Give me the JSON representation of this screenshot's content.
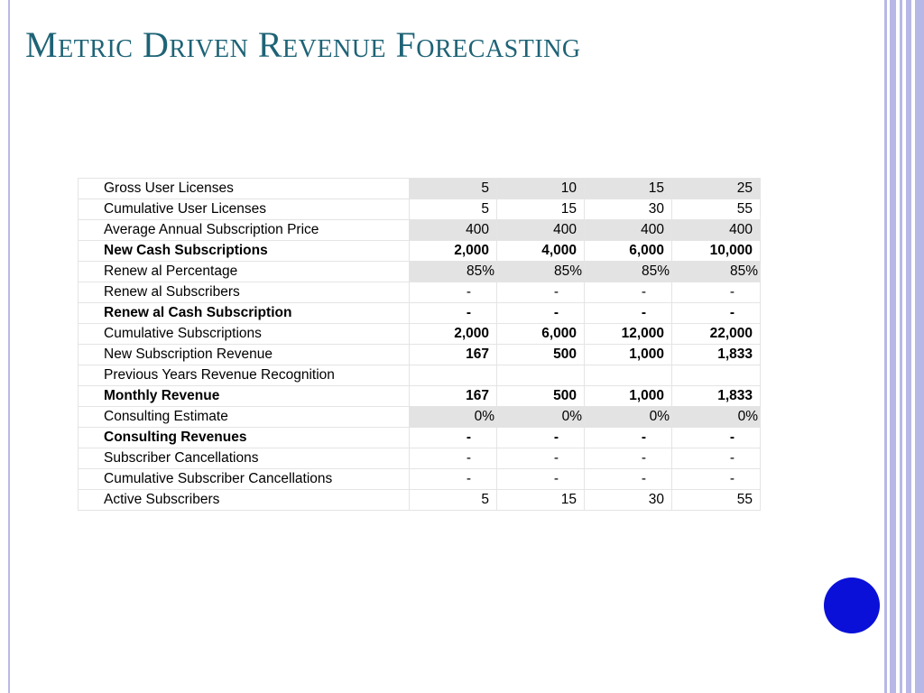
{
  "slide": {
    "title": "Metric Driven Revenue Forecasting",
    "accent_color": "#1e6376",
    "frame_color": "#b8b8e6",
    "button_color": "#0a10d8"
  },
  "table": {
    "rows": [
      {
        "label": "Gross User Licenses",
        "bold": false,
        "kind": "shaded",
        "values": [
          "5",
          "10",
          "15",
          "25"
        ]
      },
      {
        "label": "Cumulative User Licenses",
        "bold": false,
        "kind": "plain",
        "values": [
          "5",
          "15",
          "30",
          "55"
        ]
      },
      {
        "label": "Average Annual Subscription Price",
        "bold": false,
        "kind": "shaded",
        "values": [
          "400",
          "400",
          "400",
          "400"
        ]
      },
      {
        "label": "New Cash Subscriptions",
        "bold": true,
        "kind": "plain",
        "values": [
          "2,000",
          "4,000",
          "6,000",
          "10,000"
        ]
      },
      {
        "label": "Renew al Percentage",
        "bold": false,
        "kind": "pct",
        "values": [
          "85%",
          "85%",
          "85%",
          "85%"
        ]
      },
      {
        "label": "Renew al Subscribers",
        "bold": false,
        "kind": "dash",
        "values": [
          "-",
          "-",
          "-",
          "-"
        ]
      },
      {
        "label": "Renew al Cash Subscription",
        "bold": true,
        "kind": "dash",
        "values": [
          "-",
          "-",
          "-",
          "-"
        ]
      },
      {
        "label": "Cumulative Subscriptions",
        "bold": false,
        "kind": "bold-values",
        "values": [
          "2,000",
          "6,000",
          "12,000",
          "22,000"
        ]
      },
      {
        "label": "New  Subscription Revenue",
        "bold": false,
        "kind": "bold-values",
        "values": [
          "167",
          "500",
          "1,000",
          "1,833"
        ]
      },
      {
        "label": "Previous Years Revenue Recognition",
        "bold": false,
        "kind": "plain",
        "values": [
          "",
          "",
          "",
          ""
        ]
      },
      {
        "label": "Monthly Revenue",
        "bold": true,
        "kind": "plain",
        "values": [
          "167",
          "500",
          "1,000",
          "1,833"
        ]
      },
      {
        "label": "Consulting Estimate",
        "bold": false,
        "kind": "pct",
        "values": [
          "0%",
          "0%",
          "0%",
          "0%"
        ]
      },
      {
        "label": "Consulting Revenues",
        "bold": true,
        "kind": "dash",
        "values": [
          "-",
          "-",
          "-",
          "-"
        ]
      },
      {
        "label": "Subscriber Cancellations",
        "bold": false,
        "kind": "dash",
        "values": [
          "-",
          "-",
          "-",
          "-"
        ]
      },
      {
        "label": "Cumulative Subscriber Cancellations",
        "bold": false,
        "kind": "dash",
        "values": [
          "-",
          "-",
          "-",
          "-"
        ]
      },
      {
        "label": "Active Subscribers",
        "bold": false,
        "kind": "plain",
        "values": [
          "5",
          "15",
          "30",
          "55"
        ]
      }
    ]
  }
}
